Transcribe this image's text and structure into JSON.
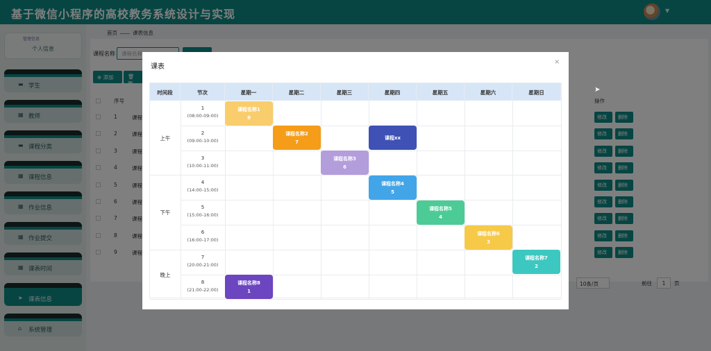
{
  "app": {
    "title": "基于微信小程序的高校教务系统设计与实现"
  },
  "sidebar": {
    "top_tiny": "管理信息",
    "top_label": "个人信息",
    "items": [
      {
        "label": "学生",
        "icon": "doc-icon",
        "active": false
      },
      {
        "label": "教师",
        "icon": "grid-icon",
        "active": false
      },
      {
        "label": "课程分类",
        "icon": "doc-icon",
        "active": false
      },
      {
        "label": "课程信息",
        "icon": "grid-icon",
        "active": false
      },
      {
        "label": "作业信息",
        "icon": "grid-icon",
        "active": false
      },
      {
        "label": "作业提交",
        "icon": "grid-icon",
        "active": false
      },
      {
        "label": "课表时间",
        "icon": "grid-icon",
        "active": false
      },
      {
        "label": "课表信息",
        "icon": "send-icon",
        "active": true
      },
      {
        "label": "系统管理",
        "icon": "home-icon",
        "active": false
      }
    ]
  },
  "breadcrumb": {
    "home": "首页",
    "current": "课表信息"
  },
  "search": {
    "label": "课程名称",
    "placeholder": "课程名称"
  },
  "toolbar": {
    "add_label": "添加",
    "delete_label": "删"
  },
  "table": {
    "header_index": "序号",
    "header_ops": "操作",
    "rows": [
      {
        "num": "1",
        "name": "课程"
      },
      {
        "num": "2",
        "name": "课程"
      },
      {
        "num": "3",
        "name": "课程"
      },
      {
        "num": "4",
        "name": "课程"
      },
      {
        "num": "5",
        "name": "课程"
      },
      {
        "num": "6",
        "name": "课程"
      },
      {
        "num": "7",
        "name": "课程"
      },
      {
        "num": "8",
        "name": "课程"
      },
      {
        "num": "9",
        "name": "课程"
      }
    ],
    "edit_label": "修改",
    "delete_label": "删除"
  },
  "pagination": {
    "page_size": "10条/页",
    "goto_label": "前往",
    "page": "1",
    "unit": "页"
  },
  "dialog": {
    "title": "课表",
    "close": "×",
    "headers": [
      "时间段",
      "节次",
      "星期一",
      "星期二",
      "星期三",
      "星期四",
      "星期五",
      "星期六",
      "星期日"
    ],
    "periods": [
      {
        "label": "上午",
        "span": 3
      },
      {
        "label": "下午",
        "span": 3
      },
      {
        "label": "晚上",
        "span": 2
      }
    ],
    "slots": [
      {
        "num": "1",
        "time": "(08:00-09:00)"
      },
      {
        "num": "2",
        "time": "(09:00-10:00)"
      },
      {
        "num": "3",
        "time": "(10:00-11:00)"
      },
      {
        "num": "4",
        "time": "(14:00-15:00)"
      },
      {
        "num": "5",
        "time": "(15:00-16:00)"
      },
      {
        "num": "6",
        "time": "(16:00-17:00)"
      },
      {
        "num": "7",
        "time": "(20:00-21:00)"
      },
      {
        "num": "8",
        "time": "(21:00-22:00)"
      }
    ],
    "courses": [
      {
        "name": "课程名称1",
        "sub": "8",
        "day": 0,
        "slot": 0,
        "color": "#f9cd6b"
      },
      {
        "name": "课程名称2",
        "sub": "7",
        "day": 1,
        "slot": 1,
        "color": "#f59c19"
      },
      {
        "name": "课程xx",
        "sub": "",
        "day": 3,
        "slot": 1,
        "color": "#3f51b5"
      },
      {
        "name": "课程名称3",
        "sub": "6",
        "day": 2,
        "slot": 2,
        "color": "#b39ddb"
      },
      {
        "name": "课程名称4",
        "sub": "5",
        "day": 3,
        "slot": 3,
        "color": "#42a5e8"
      },
      {
        "name": "课程名称5",
        "sub": "4",
        "day": 4,
        "slot": 4,
        "color": "#4ccb97"
      },
      {
        "name": "课程名称6",
        "sub": "3",
        "day": 5,
        "slot": 5,
        "color": "#f7c948"
      },
      {
        "name": "课程名称7",
        "sub": "2",
        "day": 6,
        "slot": 6,
        "color": "#3cc8c0"
      },
      {
        "name": "课程名称8",
        "sub": "1",
        "day": 0,
        "slot": 7,
        "color": "#6c45c0"
      }
    ]
  }
}
